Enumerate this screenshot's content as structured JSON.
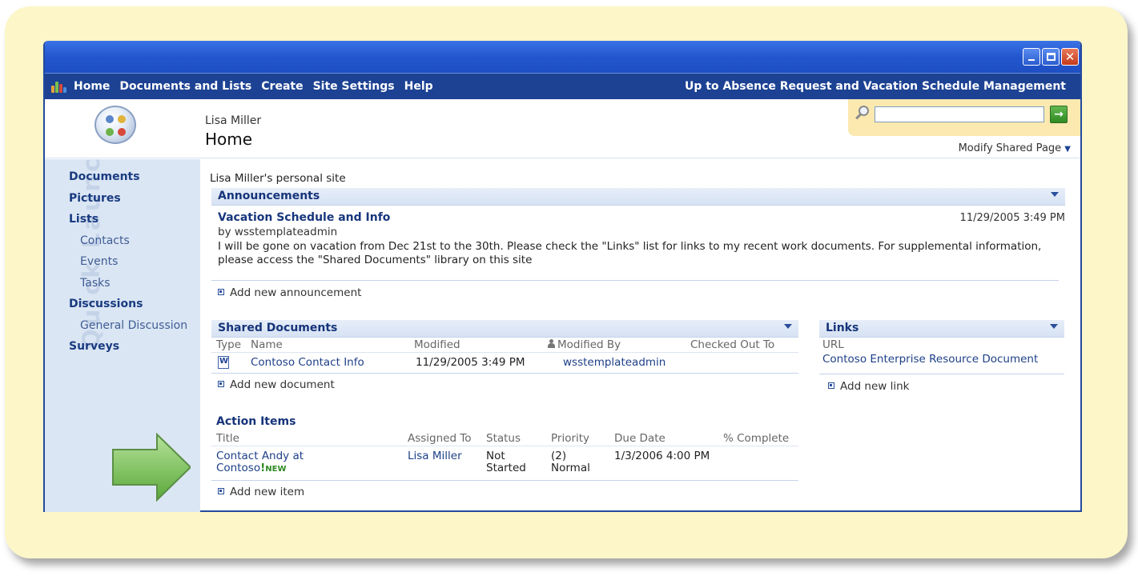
{
  "window": {
    "controls": [
      "minimize-icon",
      "maximize-icon",
      "close-icon"
    ]
  },
  "topnav": {
    "items": [
      "Home",
      "Documents and Lists",
      "Create",
      "Site Settings",
      "Help"
    ],
    "up_to": "Up to Absence Request and Vacation Schedule Management"
  },
  "header": {
    "owner": "Lisa Miller",
    "page_title": "Home",
    "search_value": "",
    "go_icon": "→",
    "modify": "Modify Shared Page"
  },
  "quicklaunch": {
    "watermark": "Quick Launch",
    "items": [
      {
        "label": "Documents",
        "level": "head"
      },
      {
        "label": "Pictures",
        "level": "head"
      },
      {
        "label": "Lists",
        "level": "head"
      },
      {
        "label": "Contacts",
        "level": "sub"
      },
      {
        "label": "Events",
        "level": "sub"
      },
      {
        "label": "Tasks",
        "level": "sub"
      },
      {
        "label": "Discussions",
        "level": "head"
      },
      {
        "label": "General Discussion",
        "level": "sub"
      },
      {
        "label": "Surveys",
        "level": "head"
      }
    ]
  },
  "main": {
    "personal_site": "Lisa Miller's personal site",
    "announcements": {
      "title": "Announcements",
      "item_title": "Vacation Schedule and Info",
      "by": "by",
      "author": "wsstemplateadmin",
      "date": "11/29/2005 3:49 PM",
      "body": "I will be gone on vacation from Dec 21st to the 30th. Please check the \"Links\" list for links to my recent work documents. For supplemental information, please access the \"Shared Documents\" library on this site",
      "add": "Add new announcement"
    },
    "shared_documents": {
      "title": "Shared Documents",
      "columns": [
        "Type",
        "Name",
        "Modified",
        "Modified By",
        "Checked Out To"
      ],
      "rows": [
        {
          "name": "Contoso Contact Info",
          "modified": "11/29/2005 3:49 PM",
          "modified_by": "wsstemplateadmin",
          "checked_out_to": ""
        }
      ],
      "add": "Add new document"
    },
    "links": {
      "title": "Links",
      "column": "URL",
      "items": [
        "Contoso Enterprise Resource Document"
      ],
      "add": "Add new link"
    },
    "action_items": {
      "title": "Action Items",
      "columns": [
        "Title",
        "Assigned To",
        "Status",
        "Priority",
        "Due Date",
        "% Complete"
      ],
      "rows": [
        {
          "title_line1": "Contact Andy at",
          "title_line2": "Contoso",
          "excl": "!",
          "new": "NEW",
          "assigned_to": "Lisa Miller",
          "status_line1": "Not",
          "status_line2": "Started",
          "priority_line1": "(2)",
          "priority_line2": "Normal",
          "due_date": "1/3/2006 4:00 PM",
          "complete": ""
        }
      ],
      "add": "Add new item"
    }
  },
  "colors": {
    "nav_bg": "#1d4293",
    "title_bar": "#2356cf",
    "quicklaunch_bg": "#dbe6f4",
    "backdrop": "#fdf6c8",
    "arrow_green": "#7dc85a"
  }
}
